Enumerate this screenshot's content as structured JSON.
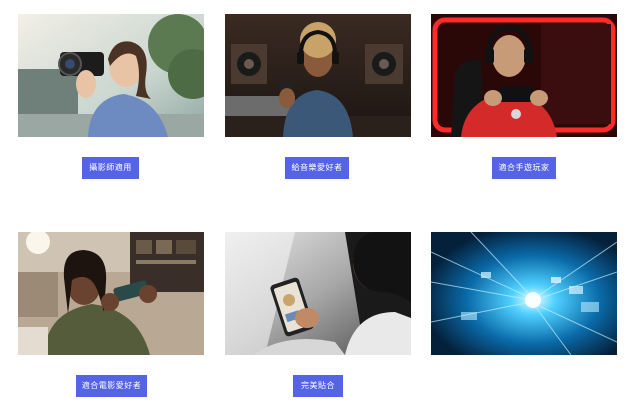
{
  "cards": [
    {
      "label": "攝影師適用",
      "image": "photographer-with-camera-photo"
    },
    {
      "label": "給音樂愛好者",
      "image": "woman-with-headphones-studio-photo"
    },
    {
      "label": "適合手遊玩家",
      "image": "mobile-gamer-red-light-photo"
    },
    {
      "label": "適合電影愛好者",
      "image": "man-watching-phone-on-sofa-photo"
    },
    {
      "label": "完美貼合",
      "image": "woman-holding-phone-photo"
    },
    {
      "label": "",
      "image": "digital-data-stream-photo"
    }
  ],
  "colors": {
    "tag_background": "#5563e6",
    "tag_text": "#ffffff",
    "page_background": "#ffffff"
  }
}
